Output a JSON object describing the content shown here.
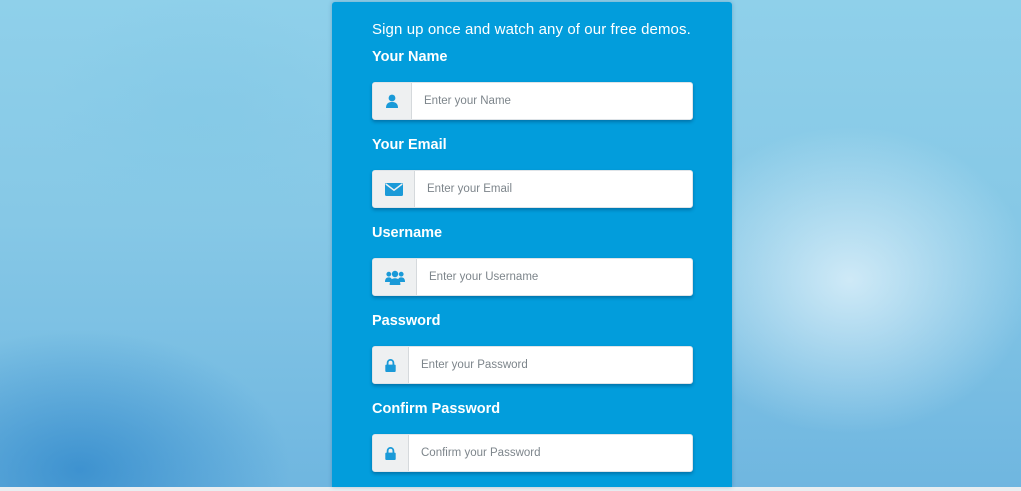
{
  "form": {
    "intro": "Sign up once and watch any of our free demos.",
    "fields": [
      {
        "label": "Your Name",
        "placeholder": "Enter your Name",
        "icon": "user-icon",
        "type": "text"
      },
      {
        "label": "Your Email",
        "placeholder": "Enter your Email",
        "icon": "envelope-icon",
        "type": "email"
      },
      {
        "label": "Username",
        "placeholder": "Enter your Username",
        "icon": "users-icon",
        "type": "text"
      },
      {
        "label": "Password",
        "placeholder": "Enter your Password",
        "icon": "lock-icon",
        "type": "password"
      },
      {
        "label": "Confirm Password",
        "placeholder": "Confirm your Password",
        "icon": "lock-icon",
        "type": "password"
      }
    ]
  },
  "colors": {
    "panel": "#029ddc",
    "icon": "#1a9ad8",
    "label_text": "#ffffff"
  }
}
